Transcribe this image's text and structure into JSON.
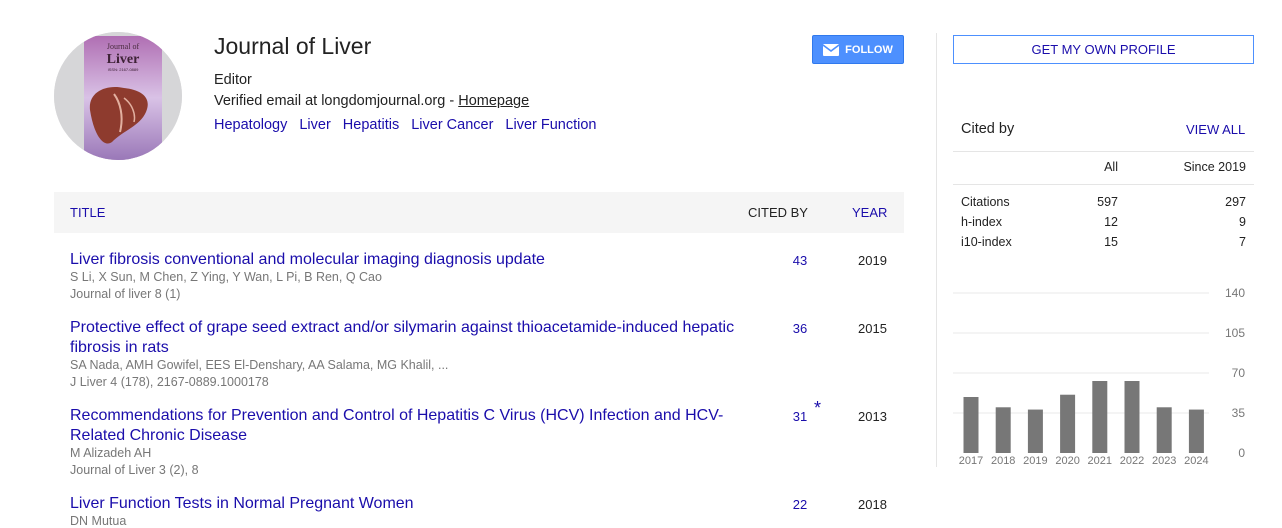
{
  "profile": {
    "name": "Journal of Liver",
    "affiliation": "Editor",
    "email_prefix": "Verified email at longdomjournal.org - ",
    "homepage_label": "Homepage",
    "interests": [
      "Hepatology",
      "Liver",
      "Hepatitis",
      "Liver Cancer",
      "Liver Function"
    ],
    "avatar": {
      "cover_title_small": "Journal of",
      "cover_title_large": "Liver",
      "cover_issn": "ISSN: 2167-0889",
      "colors": {
        "bg": "#d6d6d8",
        "cover": "#b88bb8",
        "organ": "#8e3b2e"
      }
    }
  },
  "buttons": {
    "follow": "FOLLOW",
    "get_profile": "GET MY OWN PROFILE",
    "view_all": "VIEW ALL"
  },
  "colors": {
    "link": "#1a0dab",
    "follow_bg": "#4d90fe",
    "bar": "#777777"
  },
  "table": {
    "headers": {
      "title": "TITLE",
      "cited_by": "CITED BY",
      "year": "YEAR"
    },
    "rows": [
      {
        "title": "Liver fibrosis conventional and molecular imaging diagnosis update",
        "authors": "S Li, X Sun, M Chen, Z Ying, Y Wan, L Pi, B Ren, Q Cao",
        "journal": "Journal of liver 8 (1)",
        "cited": "43",
        "star": "",
        "year": "2019"
      },
      {
        "title": "Protective effect of grape seed extract and/or silymarin against thioacetamide-induced hepatic fibrosis in rats",
        "authors": "SA Nada, AMH Gowifel, EES El-Denshary, AA Salama, MG Khalil, ...",
        "journal": "J Liver 4 (178), 2167-0889.1000178",
        "cited": "36",
        "star": "",
        "year": "2015"
      },
      {
        "title": "Recommendations for Prevention and Control of Hepatitis C Virus (HCV) Infection and HCV-Related Chronic Disease",
        "authors": "M Alizadeh AH",
        "journal": "Journal of Liver 3 (2), 8",
        "cited": "31",
        "star": "*",
        "year": "2013"
      },
      {
        "title": "Liver Function Tests in Normal Pregnant Women",
        "authors": "DN Mutua",
        "journal": "",
        "cited": "22",
        "star": "",
        "year": "2018"
      }
    ]
  },
  "cited_by": {
    "title": "Cited by",
    "col_all": "All",
    "col_since": "Since 2019",
    "rows": [
      {
        "label": "Citations",
        "all": "597",
        "since": "297"
      },
      {
        "label": "h-index",
        "all": "12",
        "since": "9"
      },
      {
        "label": "i10-index",
        "all": "15",
        "since": "7"
      }
    ]
  },
  "chart_data": {
    "type": "bar",
    "categories": [
      "2017",
      "2018",
      "2019",
      "2020",
      "2021",
      "2022",
      "2023",
      "2024"
    ],
    "values": [
      49,
      40,
      38,
      51,
      63,
      63,
      40,
      38
    ],
    "ylim": [
      0,
      140
    ],
    "yticks": [
      "0",
      "35",
      "70",
      "105",
      "140"
    ],
    "grid": true
  }
}
